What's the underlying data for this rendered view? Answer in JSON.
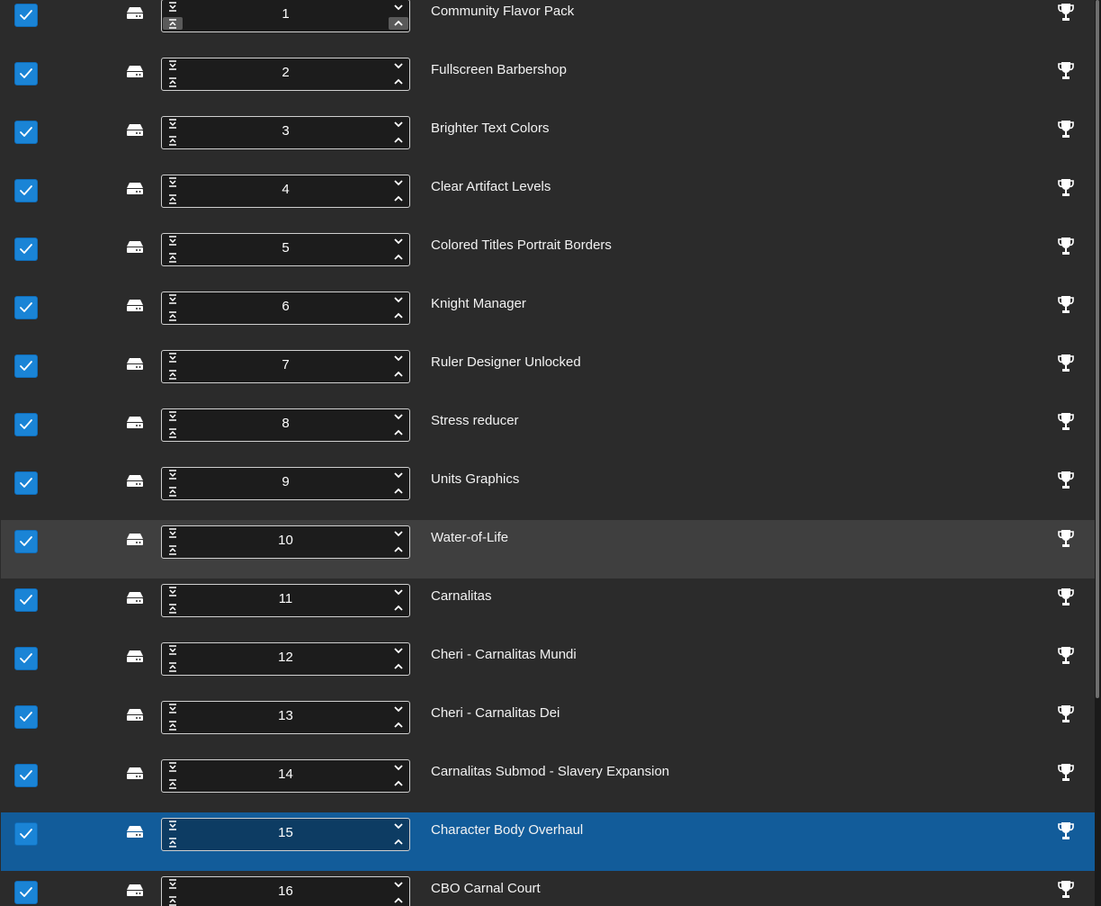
{
  "mods": [
    {
      "order": "1",
      "name": "Community Flavor Pack",
      "checked": true
    },
    {
      "order": "2",
      "name": "Fullscreen Barbershop",
      "checked": true
    },
    {
      "order": "3",
      "name": "Brighter Text Colors",
      "checked": true
    },
    {
      "order": "4",
      "name": "Clear Artifact Levels",
      "checked": true
    },
    {
      "order": "5",
      "name": "Colored Titles Portrait Borders",
      "checked": true
    },
    {
      "order": "6",
      "name": "Knight Manager",
      "checked": true
    },
    {
      "order": "7",
      "name": "Ruler Designer Unlocked",
      "checked": true
    },
    {
      "order": "8",
      "name": "Stress reducer",
      "checked": true
    },
    {
      "order": "9",
      "name": "Units Graphics",
      "checked": true
    },
    {
      "order": "10",
      "name": "Water-of-Life",
      "checked": true
    },
    {
      "order": "11",
      "name": "Carnalitas",
      "checked": true
    },
    {
      "order": "12",
      "name": "Cheri - Carnalitas Mundi",
      "checked": true
    },
    {
      "order": "13",
      "name": "Cheri - Carnalitas Dei",
      "checked": true
    },
    {
      "order": "14",
      "name": "Carnalitas Submod - Slavery Expansion",
      "checked": true
    },
    {
      "order": "15",
      "name": "Character Body Overhaul",
      "checked": true
    },
    {
      "order": "16",
      "name": "CBO Carnal Court",
      "checked": true
    }
  ],
  "hovered_row": "10",
  "selected_row": "15",
  "icons": {
    "checkbox": "check-icon",
    "source": "local-drive-icon",
    "achievement": "trophy-icon",
    "move_bottom": "move-to-bottom-icon",
    "move_top": "move-to-top-icon",
    "move_down": "chevron-down-icon",
    "move_up": "chevron-up-icon"
  },
  "colors": {
    "background": "#2b2b2b",
    "hover_row": "#3f3f3f",
    "selected_row": "#125c9a",
    "checkbox": "#1a84d6",
    "text": "#f2f2f2"
  }
}
